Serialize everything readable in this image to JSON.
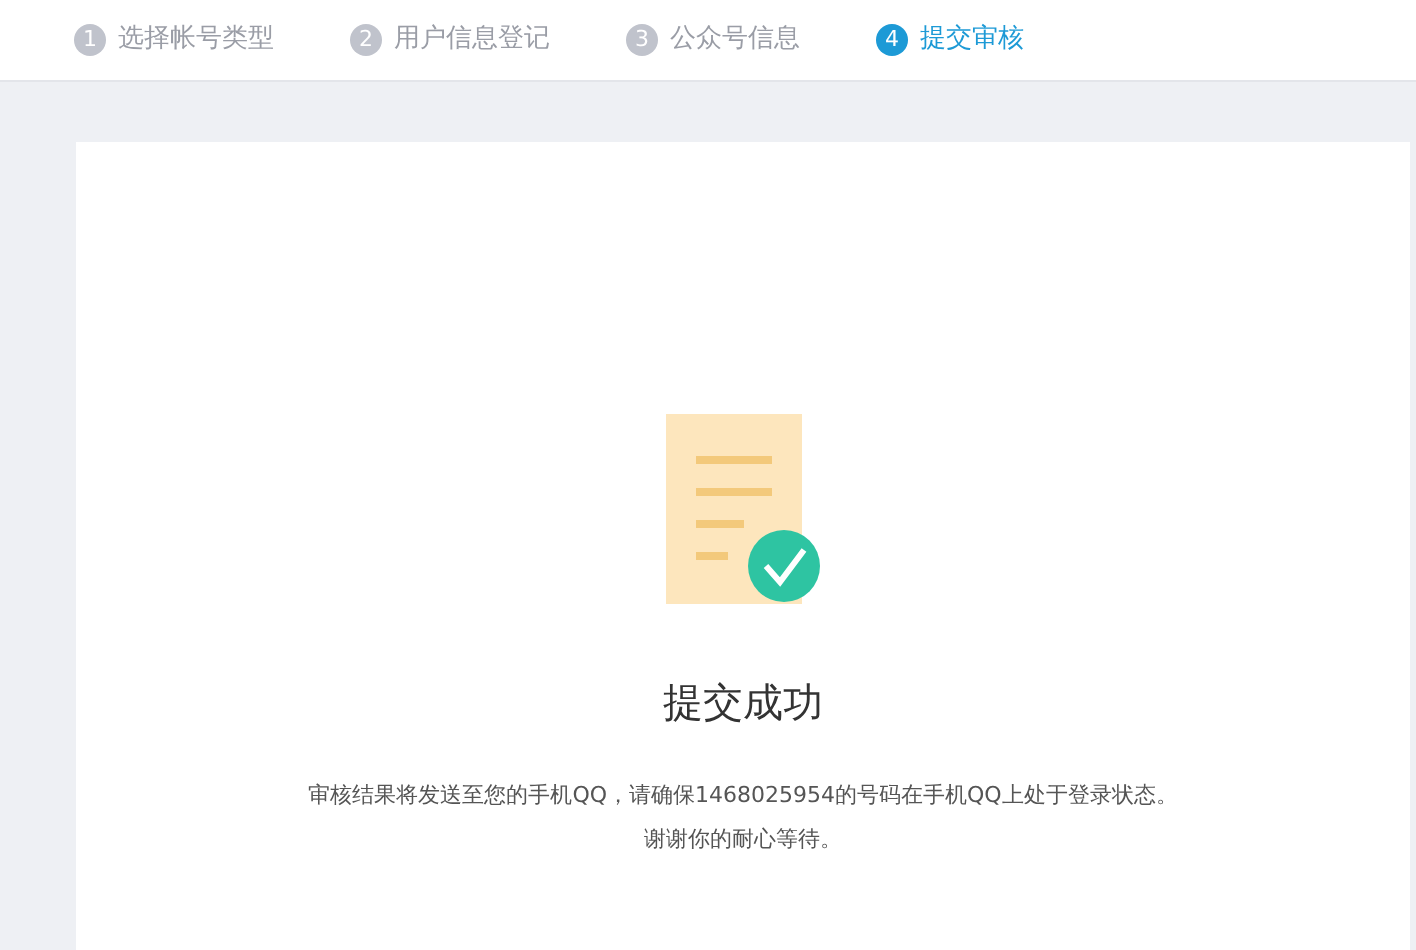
{
  "steps": [
    {
      "number": "1",
      "label": "选择帐号类型",
      "selected": false
    },
    {
      "number": "2",
      "label": "用户信息登记",
      "selected": false
    },
    {
      "number": "3",
      "label": "公众号信息",
      "selected": false
    },
    {
      "number": "4",
      "label": "提交审核",
      "selected": true
    }
  ],
  "result": {
    "title": "提交成功",
    "message": "审核结果将发送至您的手机QQ，请确保1468025954的号码在手机QQ上处于登录状态。",
    "thanks": "谢谢你的耐心等待。"
  }
}
